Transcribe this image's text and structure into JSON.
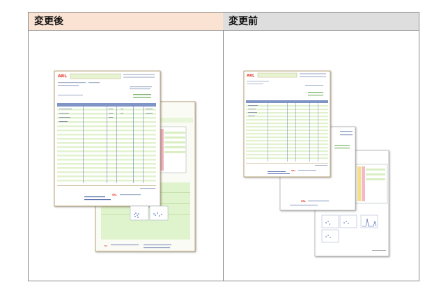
{
  "panels": {
    "after": {
      "title": "変更後"
    },
    "before": {
      "title": "変更前"
    }
  },
  "colors": {
    "after_header_bg": "#fbe3d3",
    "before_header_bg": "#dedede",
    "report_logo_red": "#e03c2a",
    "row_stripe_green": "#dff1c8",
    "table_header_blue": "#7f95c6",
    "border_tan": "#b9a47a"
  }
}
